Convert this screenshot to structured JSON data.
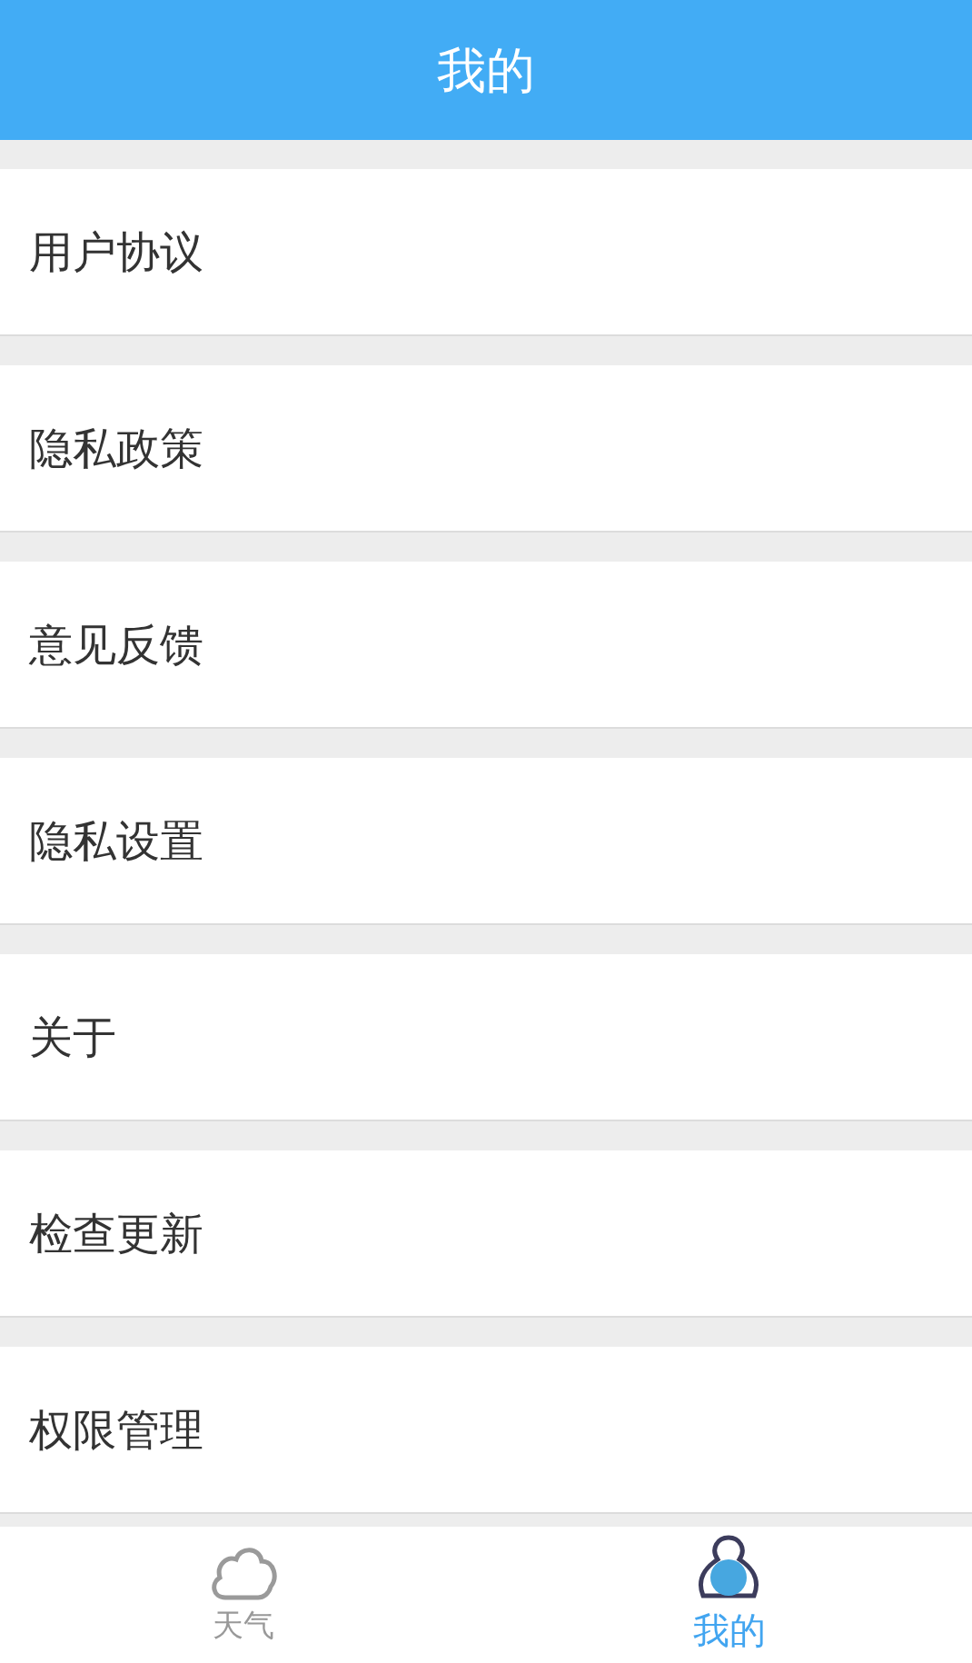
{
  "header": {
    "title": "我的"
  },
  "menu_items": [
    {
      "label": "用户协议"
    },
    {
      "label": "隐私政策"
    },
    {
      "label": "意见反馈"
    },
    {
      "label": "隐私设置"
    },
    {
      "label": "关于"
    },
    {
      "label": "检查更新"
    },
    {
      "label": "权限管理"
    }
  ],
  "tab_bar": [
    {
      "label": "天气",
      "kind": "cloud",
      "selected": false
    },
    {
      "label": "我的",
      "kind": "person",
      "selected": true
    }
  ]
}
